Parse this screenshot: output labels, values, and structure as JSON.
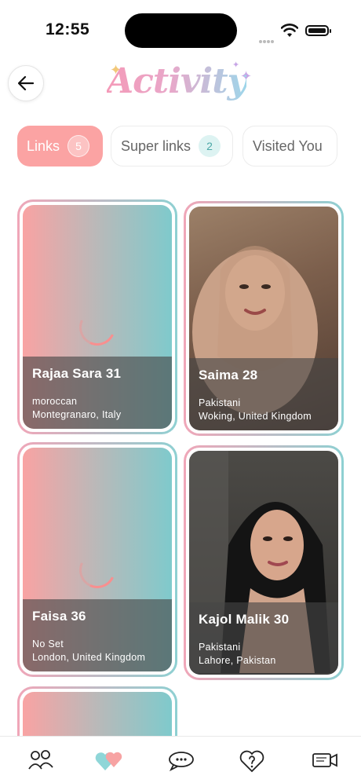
{
  "status": {
    "time": "12:55"
  },
  "header": {
    "title": "Activity"
  },
  "tabs": [
    {
      "label": "Links",
      "count": "5"
    },
    {
      "label": "Super links",
      "count": "2"
    },
    {
      "label": "Visited You"
    }
  ],
  "cards": [
    {
      "name": "Rajaa Sara 31",
      "line1": "moroccan",
      "line2": "Montegranaro, Italy",
      "photo": "loading"
    },
    {
      "name": "Saima 28",
      "line1": "Pakistani",
      "line2": "Woking, United Kingdom",
      "photo": "portrait"
    },
    {
      "name": "Faisa 36",
      "line1": "No Set",
      "line2": "London, United Kingdom",
      "photo": "loading"
    },
    {
      "name": "Kajol Malik 30",
      "line1": "Pakistani",
      "line2": "Lahore, Pakistan",
      "photo": "portrait"
    }
  ],
  "nav": {
    "items": [
      {
        "icon": "users-icon"
      },
      {
        "icon": "hearts-icon"
      },
      {
        "icon": "chat-icon"
      },
      {
        "icon": "question-heart-icon"
      },
      {
        "icon": "video-icon"
      }
    ]
  },
  "colors": {
    "accent": "#fba3a3",
    "teal": "#8ed0d2"
  }
}
